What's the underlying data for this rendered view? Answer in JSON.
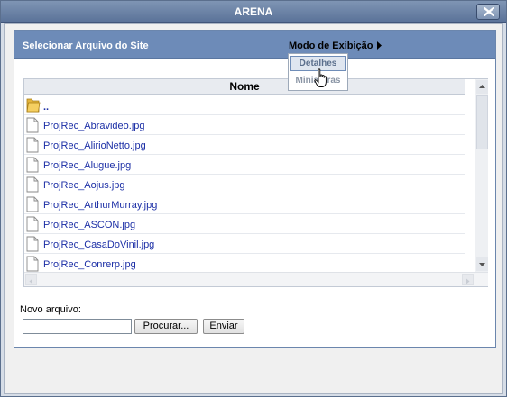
{
  "window": {
    "title": "ARENA"
  },
  "header": {
    "title": "Selecionar Arquivo do Site",
    "view_mode": "Modo de Exibição"
  },
  "view_menu": {
    "items": [
      {
        "label": "Detalhes"
      },
      {
        "label": "Miniaturas"
      }
    ]
  },
  "list": {
    "column_header": "Nome",
    "rows": [
      {
        "name": "..",
        "type": "folder"
      },
      {
        "name": "ProjRec_Abravideo.jpg",
        "type": "file"
      },
      {
        "name": "ProjRec_AlirioNetto.jpg",
        "type": "file"
      },
      {
        "name": "ProjRec_Alugue.jpg",
        "type": "file"
      },
      {
        "name": "ProjRec_Aojus.jpg",
        "type": "file"
      },
      {
        "name": "ProjRec_ArthurMurray.jpg",
        "type": "file"
      },
      {
        "name": "ProjRec_ASCON.jpg",
        "type": "file"
      },
      {
        "name": "ProjRec_CasaDoVinil.jpg",
        "type": "file"
      },
      {
        "name": "ProjRec_Conrerp.jpg",
        "type": "file"
      }
    ]
  },
  "upload": {
    "label": "Novo arquivo:",
    "input_value": "",
    "browse_label": "Procurar...",
    "send_label": "Enviar"
  }
}
